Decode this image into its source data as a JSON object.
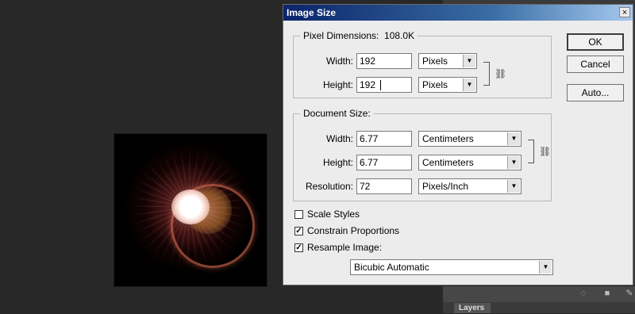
{
  "dialog": {
    "title": "Image Size",
    "close_icon": "×",
    "buttons": {
      "ok": "OK",
      "cancel": "Cancel",
      "auto": "Auto..."
    },
    "pixel_dimensions": {
      "legend": "Pixel Dimensions:",
      "size": "108.0K",
      "width_label": "Width:",
      "width_value": "192",
      "width_unit": "Pixels",
      "height_label": "Height:",
      "height_value": "192",
      "height_unit": "Pixels"
    },
    "document_size": {
      "legend": "Document Size:",
      "width_label": "Width:",
      "width_value": "6.77",
      "width_unit": "Centimeters",
      "height_label": "Height:",
      "height_value": "6.77",
      "height_unit": "Centimeters",
      "resolution_label": "Resolution:",
      "resolution_value": "72",
      "resolution_unit": "Pixels/Inch"
    },
    "options": {
      "scale_styles": {
        "label": "Scale Styles",
        "checked": false
      },
      "constrain_proportions": {
        "label": "Constrain Proportions",
        "checked": true
      },
      "resample_image": {
        "label": "Resample Image:",
        "checked": true
      }
    },
    "resample_method": "Bicubic Automatic"
  },
  "panel": {
    "layers_tab": "Layers"
  },
  "icons": {
    "link": "chain-link-icon",
    "dropdown": "chevron-down-icon",
    "check": "checkmark-icon"
  }
}
